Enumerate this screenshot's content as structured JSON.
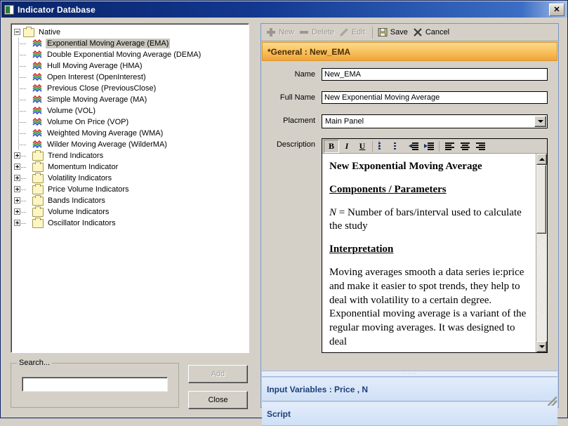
{
  "window": {
    "title": "Indicator Database",
    "close_label": "✕",
    "app_icon": "app-icon"
  },
  "tree": {
    "root": {
      "label": "Native",
      "expanded": true,
      "children": [
        {
          "label": "Exponential Moving Average (EMA)",
          "selected": true
        },
        {
          "label": "Double Exponential Moving Average (DEMA)",
          "selected": false
        },
        {
          "label": "Hull Moving Average (HMA)",
          "selected": false
        },
        {
          "label": "Open Interest (OpenInterest)",
          "selected": false
        },
        {
          "label": "Previous Close (PreviousClose)",
          "selected": false
        },
        {
          "label": "Simple Moving Average (MA)",
          "selected": false
        },
        {
          "label": "Volume (VOL)",
          "selected": false
        },
        {
          "label": "Volume On Price (VOP)",
          "selected": false
        },
        {
          "label": "Weighted Moving Average (WMA)",
          "selected": false
        },
        {
          "label": "Wilder Moving Average (WilderMA)",
          "selected": false
        }
      ]
    },
    "folders": [
      {
        "label": "Trend Indicators"
      },
      {
        "label": "Momentum Indicator"
      },
      {
        "label": "Volatility Indicators"
      },
      {
        "label": "Price Volume Indicators"
      },
      {
        "label": "Bands Indicators"
      },
      {
        "label": "Volume Indicators"
      },
      {
        "label": "Oscillator Indicators"
      }
    ]
  },
  "search": {
    "group_title": "Search...",
    "value": "",
    "placeholder": ""
  },
  "buttons": {
    "add": "Add",
    "add_enabled": false,
    "close": "Close",
    "close_enabled": true
  },
  "toolbar": {
    "new": "New",
    "delete": "Delete",
    "edit": "Edit",
    "save": "Save",
    "cancel": "Cancel"
  },
  "header": {
    "title": "*General : New_EMA"
  },
  "form": {
    "name_label": "Name",
    "name_value": "New_EMA",
    "fullname_label": "Full Name",
    "fullname_value": "New Exponential Moving Average",
    "placement_label": "Placment",
    "placement_value": "Main Panel",
    "description_label": "Description"
  },
  "rte": {
    "bold": "B",
    "italic": "I",
    "underline": "U",
    "numbered_list": "numbered-list-icon",
    "bullet_list": "bullet-list-icon",
    "decrease_indent": "decrease-indent-icon",
    "increase_indent": "increase-indent-icon",
    "align_left": "align-left-icon",
    "align_center": "align-center-icon",
    "align_right": "align-right-icon"
  },
  "description": {
    "heading": "New Exponential Moving Average",
    "section1": "Components / Parameters",
    "param_var": "N",
    "param_text": " = Number of bars/interval used to calculate the study",
    "section2": "Interpretation",
    "body": "Moving averages smooth a data series ie:price and make it easier to spot trends, they help to deal with volatility to a certain degree. Exponential moving average is a variant of the regular moving averages. It was designed to deal"
  },
  "accordion": {
    "input_variables": "Input Variables : Price , N",
    "script": "Script"
  },
  "colors": {
    "titlebar": "#0a246a",
    "accent_orange": "#f2a43a",
    "accordion_blue": "#cfe0f6",
    "window_bg": "#d4d0c8"
  }
}
